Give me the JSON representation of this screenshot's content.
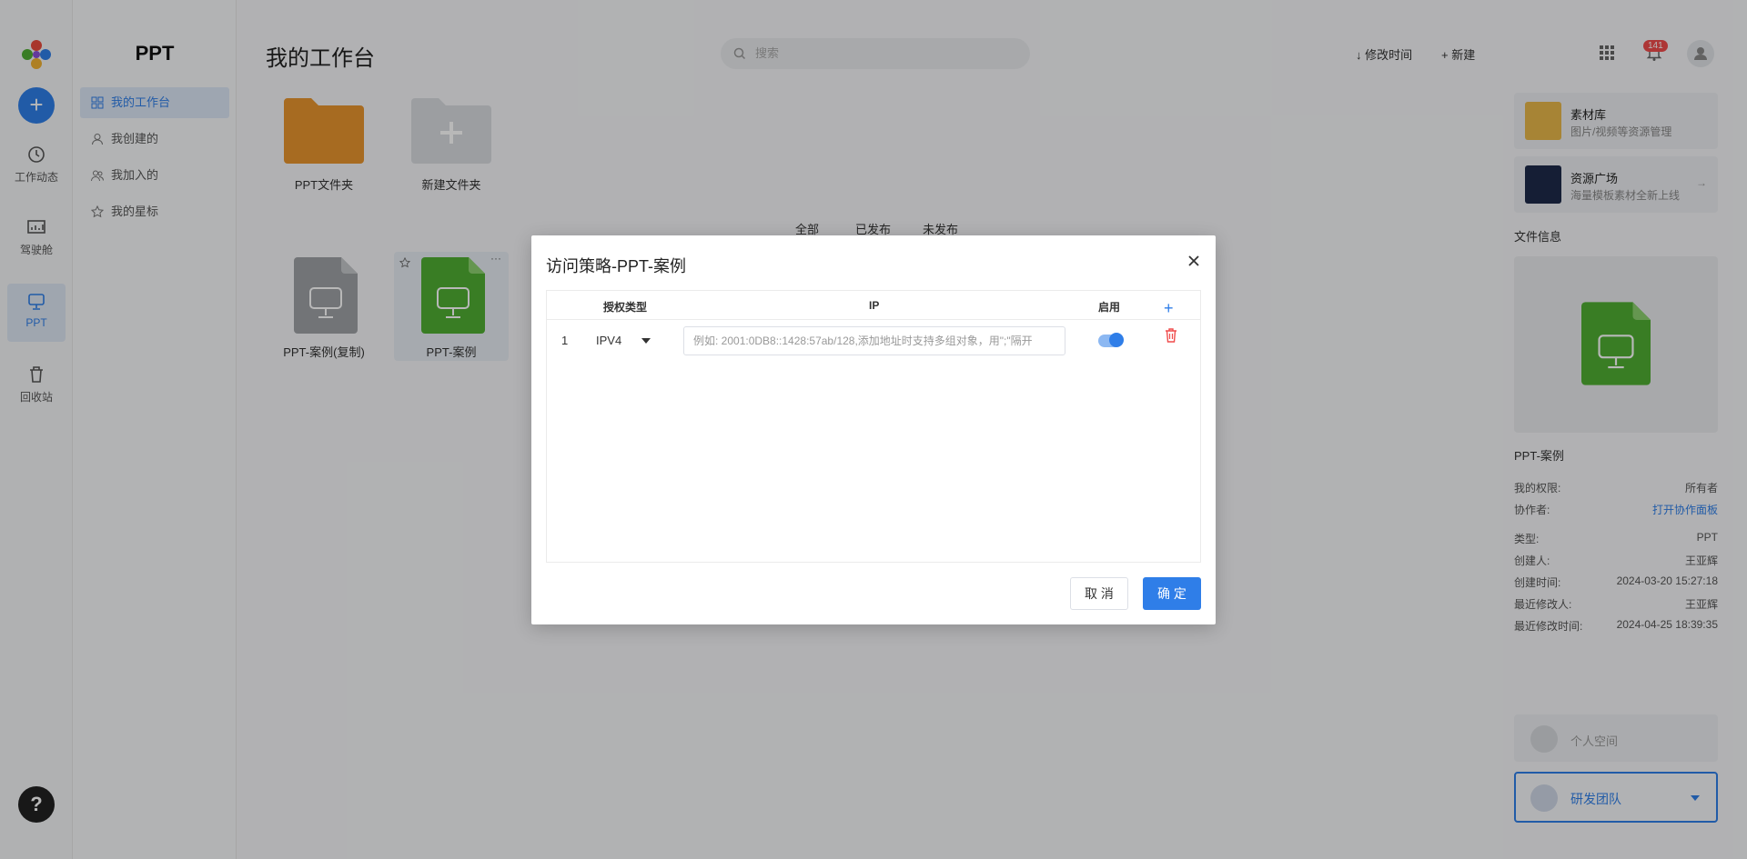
{
  "rail": {
    "items": [
      {
        "label": "工作动态",
        "icon": "clock-icon"
      },
      {
        "label": "驾驶舱",
        "icon": "dashboard-icon"
      },
      {
        "label": "PPT",
        "icon": "presentation-icon"
      },
      {
        "label": "回收站",
        "icon": "trash-icon"
      }
    ],
    "help": "?"
  },
  "sidebar": {
    "title": "PPT",
    "items": [
      {
        "label": "我的工作台",
        "icon": "grid-icon"
      },
      {
        "label": "我创建的",
        "icon": "user-icon"
      },
      {
        "label": "我加入的",
        "icon": "users-icon"
      },
      {
        "label": "我的星标",
        "icon": "star-icon"
      }
    ]
  },
  "main": {
    "title": "我的工作台",
    "search_placeholder": "搜索",
    "sort_label": "修改时间",
    "new_label": "新建",
    "notification_count": "141",
    "folders": [
      {
        "label": "PPT文件夹"
      },
      {
        "label": "新建文件夹"
      }
    ],
    "tabs": [
      "全部",
      "已发布",
      "未发布"
    ],
    "files": [
      {
        "label": "PPT-案例(复制)"
      },
      {
        "label": "PPT-案例"
      }
    ]
  },
  "right_panel": {
    "material": {
      "title": "素材库",
      "subtitle": "图片/视频等资源管理"
    },
    "resource": {
      "title": "资源广场",
      "subtitle": "海量模板素材全新上线"
    },
    "file_info_label": "文件信息",
    "file_name": "PPT-案例",
    "info": [
      {
        "k": "我的权限:",
        "v": "所有者"
      },
      {
        "k": "协作者:",
        "v": "打开协作面板"
      },
      {
        "k": "类型:",
        "v": "PPT"
      },
      {
        "k": "创建人:",
        "v": "王亚辉"
      },
      {
        "k": "创建时间:",
        "v": "2024-03-20 15:27:18"
      },
      {
        "k": "最近修改人:",
        "v": "王亚辉"
      },
      {
        "k": "最近修改时间:",
        "v": "2024-04-25 18:39:35"
      }
    ],
    "personal_space": "个人空间",
    "team": "研发团队"
  },
  "modal": {
    "title": "访问策略-PPT-案例",
    "columns": {
      "type": "授权类型",
      "ip": "IP",
      "enabled": "启用",
      "add": "+"
    },
    "rows": [
      {
        "no": "1",
        "type": "IPV4",
        "ip_value": "",
        "ip_placeholder": "例如: 2001:0DB8::1428:57ab/128,添加地址时支持多组对象，用\";\"隔开",
        "enabled": true
      }
    ],
    "cancel": "取 消",
    "ok": "确 定"
  },
  "colors": {
    "accent": "#2f7ee8",
    "folder": "#e8952f",
    "ppt_green": "#4fae32",
    "danger": "#f04c4c"
  }
}
